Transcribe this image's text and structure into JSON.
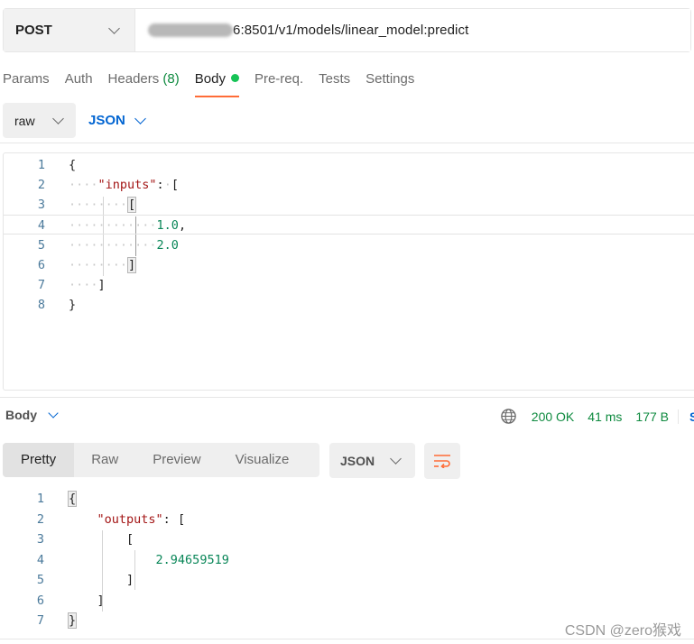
{
  "request": {
    "method": "POST",
    "url_visible": "6:8501/v1/models/linear_model:predict"
  },
  "tabs": [
    {
      "label": "Params"
    },
    {
      "label": "Auth"
    },
    {
      "label": "Headers",
      "count": "(8)"
    },
    {
      "label": "Body"
    },
    {
      "label": "Pre-req."
    },
    {
      "label": "Tests"
    },
    {
      "label": "Settings"
    }
  ],
  "body_mode": {
    "type": "raw",
    "language": "JSON"
  },
  "request_body_lines": [
    "1",
    "2",
    "3",
    "4",
    "5",
    "6",
    "7",
    "8"
  ],
  "request_tokens": {
    "open_brace": "{",
    "key_inputs": "\"inputs\"",
    "colon": ":",
    "open_bracket": "[",
    "val1": "1.0",
    "comma": ",",
    "val2": "2.0",
    "close_bracket": "]",
    "close_brace": "}"
  },
  "response": {
    "section_label": "Body",
    "status": "200 OK",
    "time": "41 ms",
    "size": "177 B",
    "save_truncated": "S",
    "view_tabs": [
      "Pretty",
      "Raw",
      "Preview",
      "Visualize"
    ],
    "format": "JSON",
    "lines": [
      "1",
      "2",
      "3",
      "4",
      "5",
      "6",
      "7"
    ],
    "tokens": {
      "open_brace": "{",
      "key_outputs": "\"outputs\"",
      "colon": ":",
      "open_bracket": "[",
      "value": "2.94659519",
      "close_bracket": "]",
      "close_brace": "}"
    }
  },
  "watermark": "CSDN @zero猴戏",
  "colors": {
    "accent": "#ff6c37",
    "status_green": "#0e8a3f",
    "link_blue": "#0265d2",
    "body_dot": "#16c356"
  }
}
